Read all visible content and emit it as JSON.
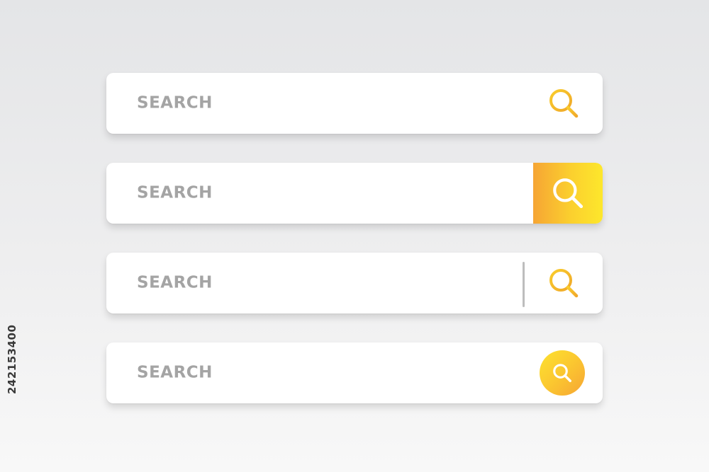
{
  "search_bars": [
    {
      "style": "plain-icon",
      "placeholder": "SEARCH",
      "icon": "search-icon",
      "icon_color": "#f3b61f"
    },
    {
      "style": "gradient-square-button",
      "placeholder": "SEARCH",
      "icon": "search-icon",
      "icon_color": "#ffffff",
      "button_gradient": [
        "#f6a534",
        "#fde72c"
      ]
    },
    {
      "style": "divider-icon",
      "placeholder": "SEARCH",
      "icon": "search-icon",
      "icon_color": "#f3b61f",
      "divider_color": "#bdbdbd"
    },
    {
      "style": "gradient-round-button",
      "placeholder": "SEARCH",
      "icon": "search-icon",
      "icon_color": "#ffffff",
      "button_gradient": [
        "#fde22f",
        "#f6a534"
      ]
    }
  ],
  "watermark": {
    "stock_id": "242153400"
  },
  "colors": {
    "placeholder_text": "#a4a4a4",
    "bar_background": "#ffffff",
    "page_background": "#e8e9ea"
  }
}
